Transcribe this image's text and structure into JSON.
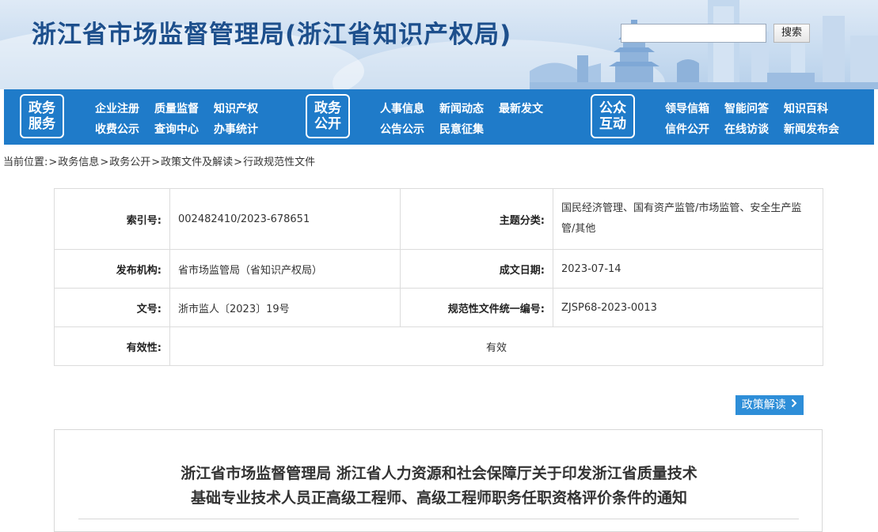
{
  "header": {
    "site_title": "浙江省市场监督管理局(浙江省知识产权局)",
    "search_placeholder": "",
    "search_button": "搜索"
  },
  "nav": {
    "groups": [
      {
        "badge": [
          "政务",
          "服务"
        ],
        "links": [
          [
            "企业注册",
            "质量监督",
            "知识产权"
          ],
          [
            "收费公示",
            "查询中心",
            "办事统计"
          ]
        ]
      },
      {
        "badge": [
          "政务",
          "公开"
        ],
        "links": [
          [
            "人事信息",
            "新闻动态",
            "最新发文"
          ],
          [
            "公告公示",
            "民意征集"
          ]
        ]
      },
      {
        "badge": [
          "公众",
          "互动"
        ],
        "links": [
          [
            "领导信箱",
            "智能问答",
            "知识百科"
          ],
          [
            "信件公开",
            "在线访谈",
            "新闻发布会"
          ]
        ]
      }
    ]
  },
  "breadcrumb": {
    "prefix": "当前位置:",
    "items": [
      "政务信息",
      "政务公开",
      "政策文件及解读",
      "行政规范性文件"
    ]
  },
  "info_table": {
    "index_label": "索引号:",
    "index_value": "002482410/2023-678651",
    "topic_label": "主题分类:",
    "topic_value": "国民经济管理、国有资产监管/市场监管、安全生产监管/其他",
    "issuer_label": "发布机构:",
    "issuer_value": "省市场监管局（省知识产权局）",
    "date_label": "成文日期:",
    "date_value": "2023-07-14",
    "docno_label": "文号:",
    "docno_value": "浙市监人〔2023〕19号",
    "code_label": "规范性文件统一编号:",
    "code_value": "ZJSP68-2023-0013",
    "validity_label": "有效性:",
    "validity_value": "有效"
  },
  "policy_button": "政策解读",
  "article": {
    "title_line1": "浙江省市场监督管理局 浙江省人力资源和社会保障厅关于印发浙江省质量技术",
    "title_line2": "基础专业技术人员正高级工程师、高级工程师职务任职资格评价条件的通知"
  },
  "colors": {
    "nav_bg": "#1f7bc9",
    "title": "#1d4f8c",
    "button_bg": "#2e8ed8"
  }
}
